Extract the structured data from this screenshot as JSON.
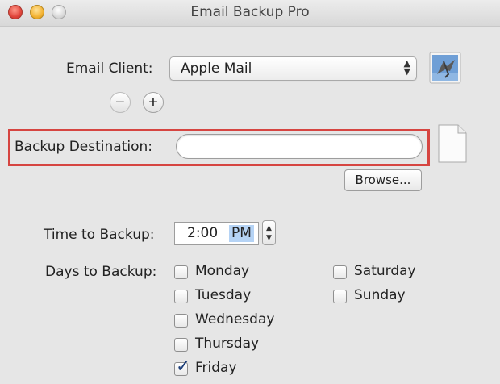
{
  "window": {
    "title": "Email Backup Pro"
  },
  "email_client": {
    "label": "Email Client:",
    "selected": "Apple Mail",
    "icon": "mail-stamp-icon",
    "minus_label": "−",
    "plus_label": "+"
  },
  "backup_destination": {
    "label": "Backup Destination:",
    "value": "",
    "highlight_color": "#d64541",
    "browse_label": "Browse..."
  },
  "time": {
    "label": "Time to Backup:",
    "hour_minute": "2:00",
    "ampm": "PM"
  },
  "days": {
    "label": "Days to Backup:",
    "items": [
      {
        "name": "Monday",
        "checked": false
      },
      {
        "name": "Tuesday",
        "checked": false
      },
      {
        "name": "Wednesday",
        "checked": false
      },
      {
        "name": "Thursday",
        "checked": false
      },
      {
        "name": "Friday",
        "checked": true
      },
      {
        "name": "Saturday",
        "checked": false
      },
      {
        "name": "Sunday",
        "checked": false
      }
    ]
  }
}
